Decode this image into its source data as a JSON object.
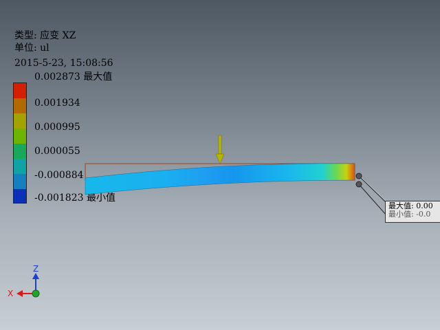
{
  "info": {
    "type_line": "类型: 应变 XZ",
    "unit_line": "单位: ul",
    "timestamp": "2015-5-23, 15:08:56"
  },
  "legend": {
    "labels": [
      "0.002873 最大值",
      "0.001934",
      "0.000995",
      "0.000055",
      "-0.000884",
      "-0.001823 最小值"
    ],
    "colors": [
      "#d41f00",
      "#b26a00",
      "#a3a300",
      "#6cb400",
      "#17a85b",
      "#10a3a5",
      "#157fbf",
      "#0a2fb8"
    ]
  },
  "probe": {
    "line1": "最大值: 0.00",
    "line2": "最小值: -0.0"
  },
  "axes": {
    "x_label": "X",
    "z_label": "Z",
    "x_color": "#d8181a",
    "z_color": "#1a3fd1",
    "origin_color": "#1fa52b"
  },
  "load_arrow": {
    "color": "#b6b600"
  }
}
